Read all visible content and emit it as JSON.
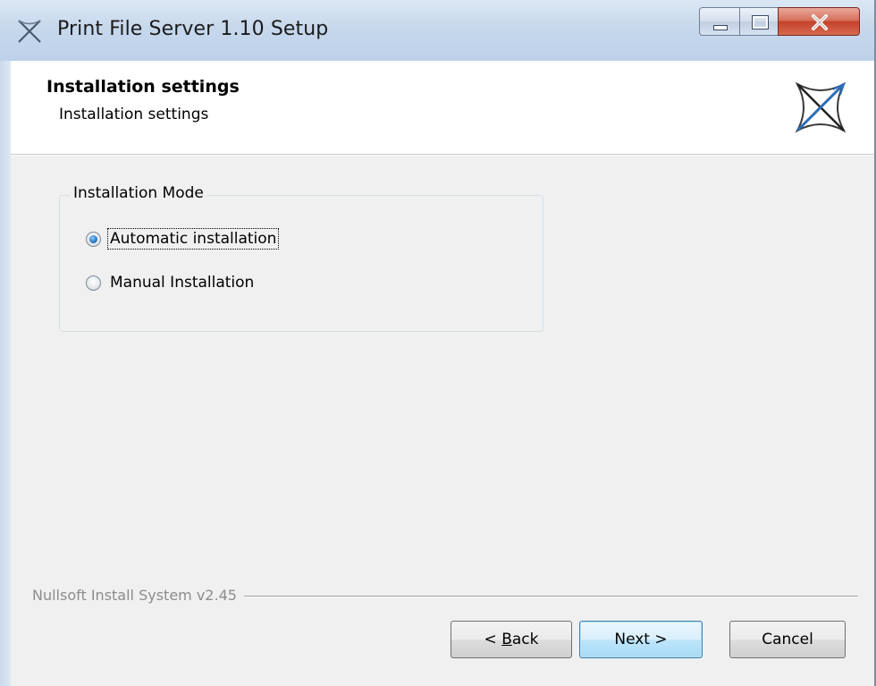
{
  "window": {
    "title": "Print File Server 1.10 Setup",
    "app_icon": "nsis-x-icon",
    "controls": {
      "minimize": "minimize-icon",
      "maximize": "maximize-icon",
      "close": "close-icon"
    },
    "close_color": "#c4422b"
  },
  "header": {
    "title": "Installation settings",
    "subtitle": "Installation settings",
    "logo": "nsis-logo-icon"
  },
  "group": {
    "legend": "Installation Mode",
    "options": [
      {
        "label": "Automatic installation",
        "checked": true,
        "focused": true
      },
      {
        "label": "Manual Installation",
        "checked": false,
        "focused": false
      }
    ]
  },
  "branding": "Nullsoft Install System v2.45",
  "buttons": {
    "back_prefix": "< ",
    "back_mnemonic": "B",
    "back_rest": "ack",
    "next": "Next >",
    "cancel": "Cancel"
  },
  "colors": {
    "accent": "#2a7fcd",
    "default_button_border": "#3c7fb1"
  }
}
